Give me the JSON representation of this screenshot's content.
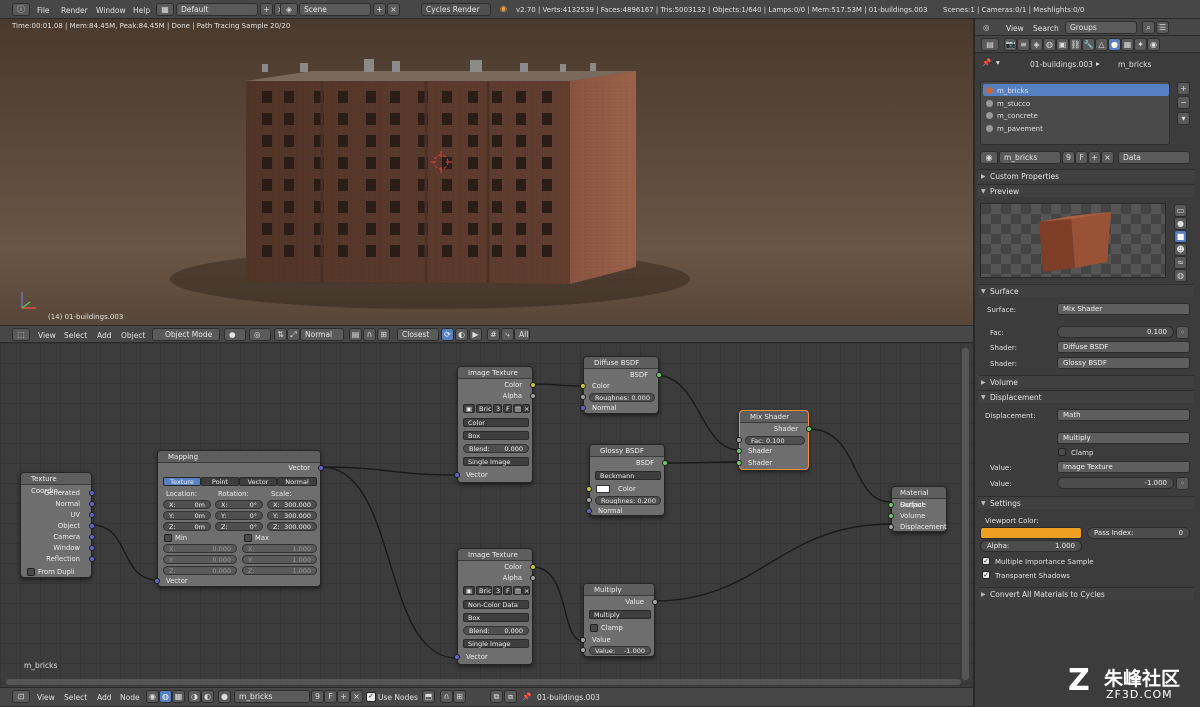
{
  "topbar": {
    "menus": [
      "File",
      "Render",
      "Window",
      "Help"
    ],
    "screen": "Default",
    "scene": "Scene",
    "engine": "Cycles Render",
    "stats": "v2.70 | Verts:4132539 | Faces:4896167 | Tris:5003132 | Objects:1/640 | Lamps:0/0 | Mem:517.53M | 01-buildings.003",
    "scenes": "Scenes:1 | Cameras:0/1 | Meshlights:0/0"
  },
  "viewport": {
    "status": "Time:00:01.08 | Mem:84.45M, Peak:84.45M | Done | Path Tracing Sample 20/20",
    "object_label": "(14) 01-buildings.003",
    "header": {
      "menus": [
        "View",
        "Select",
        "Add",
        "Object"
      ],
      "mode": "Object Mode",
      "shading": "Normal",
      "snap": "Closest",
      "all": "All"
    }
  },
  "nodes": {
    "texcoord": {
      "title": "Texture Coordin...",
      "outputs": [
        "Generated",
        "Normal",
        "UV",
        "Object",
        "Camera",
        "Window",
        "Reflection"
      ],
      "from_dupli": "From Dupli"
    },
    "mapping": {
      "title": "Mapping",
      "out": "Vector",
      "tabs": [
        "Texture",
        "Point",
        "Vector",
        "Normal"
      ],
      "location": "Location:",
      "rotation": "Rotation:",
      "scale": "Scale:",
      "loc": [
        "X:",
        "0m",
        "Y:",
        "0m",
        "Z:",
        "0m"
      ],
      "rot": [
        "X:",
        "0°",
        "Y:",
        "0°",
        "Z:",
        "0°"
      ],
      "scl": [
        "X:",
        "300.000",
        "Y:",
        "300.000",
        "Z:",
        "300.000"
      ],
      "min": "Min",
      "max": "Max",
      "minv": [
        "X:",
        "0.000",
        "Y:",
        "0.000",
        "Z:",
        "0.000"
      ],
      "maxv": [
        "X:",
        "1.000",
        "Y:",
        "1.000",
        "Z:",
        "1.000"
      ],
      "in": "Vector"
    },
    "img1": {
      "title": "Image Texture",
      "color": "Color",
      "alpha": "Alpha",
      "name": "Bric",
      "users": "3",
      "f": "F",
      "space": "Color",
      "proj": "Box",
      "blend": "Blend:",
      "blend_val": "0.000",
      "source": "Single Image",
      "in": "Vector"
    },
    "img2": {
      "title": "Image Texture",
      "color": "Color",
      "alpha": "Alpha",
      "name": "Bric",
      "users": "3",
      "f": "F",
      "space": "Non-Color Data",
      "proj": "Box",
      "blend": "Blend:",
      "blend_val": "0.000",
      "source": "Single Image",
      "in": "Vector"
    },
    "diffuse": {
      "title": "Diffuse BSDF",
      "out": "BSDF",
      "color": "Color",
      "rough": "Roughnes:",
      "rough_val": "0.000",
      "normal": "Normal"
    },
    "glossy": {
      "title": "Glossy BSDF",
      "out": "BSDF",
      "dist": "Beckmann",
      "color": "Color",
      "rough": "Roughnes:",
      "rough_val": "0.200",
      "normal": "Normal"
    },
    "mix": {
      "title": "Mix Shader",
      "out": "Shader",
      "fac": "Fac:",
      "fac_val": "0.100",
      "s1": "Shader",
      "s2": "Shader"
    },
    "multiply": {
      "title": "Multiply",
      "out": "Value",
      "op": "Multiply",
      "clamp": "Clamp",
      "value": "Value",
      "val": "Value:",
      "val_num": "-1.000"
    },
    "output": {
      "title": "Material Output",
      "inputs": [
        "Surface",
        "Volume",
        "Displacement"
      ]
    }
  },
  "node_editor": {
    "material_label": "m_bricks",
    "header": {
      "menus": [
        "View",
        "Select",
        "Add",
        "Node"
      ],
      "material": "m_bricks",
      "users": "9",
      "f": "F",
      "use_nodes": "Use Nodes",
      "object": "01-buildings.003"
    }
  },
  "properties": {
    "header": {
      "view": "View",
      "search": "Search",
      "groups": "Groups"
    },
    "breadcrumb": [
      "01-buildings.003",
      "m_bricks"
    ],
    "materials": [
      "m_bricks",
      "m_stucco",
      "m_concrete",
      "m_pavement"
    ],
    "mat_field": "m_bricks",
    "users": "9",
    "f": "F",
    "link": "Data",
    "custom_props": "Custom Properties",
    "preview": "Preview",
    "surface_panel": "Surface",
    "surface": {
      "label": "Surface:",
      "value": "Mix Shader",
      "fac": "Fac:",
      "fac_val": "0.100",
      "shader1_label": "Shader:",
      "shader1": "Diffuse BSDF",
      "shader2_label": "Shader:",
      "shader2": "Glossy BSDF"
    },
    "volume": "Volume",
    "displacement_panel": "Displacement",
    "displacement": {
      "label": "Displacement:",
      "value": "Math",
      "op": "Multiply",
      "clamp": "Clamp",
      "value_label": "Value:",
      "value_node": "Image Texture",
      "value2_label": "Value:",
      "value2": "-1.000"
    },
    "settings": "Settings",
    "viewport_color": "Viewport Color:",
    "alpha": "Alpha:",
    "alpha_val": "1.000",
    "pass_index": "Pass Index:",
    "pass_val": "0",
    "mis": "Multiple Importance Sample",
    "transparent": "Transparent Shadows",
    "convert": "Convert All Materials to Cycles"
  },
  "watermark": {
    "brand": "朱峰社区",
    "url": "ZF3D.COM"
  },
  "colors": {
    "accent": "#5680c2",
    "viewport_color": "#f0a020",
    "selected_node": "#e8943a"
  }
}
